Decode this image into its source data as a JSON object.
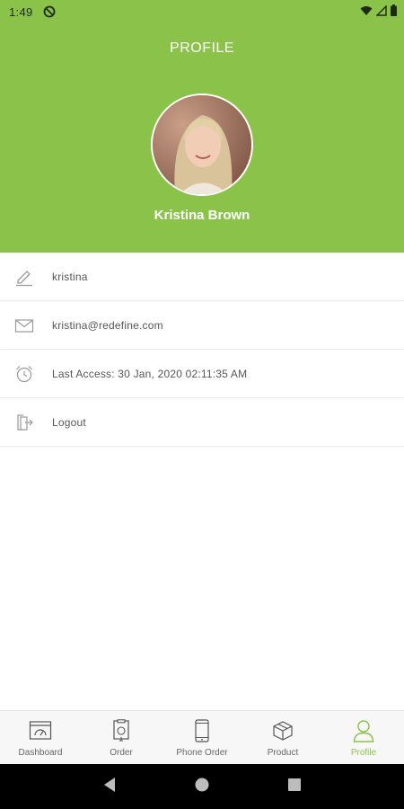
{
  "status_bar": {
    "time": "1:49"
  },
  "header": {
    "title": "PROFILE",
    "user_name": "Kristina Brown",
    "color": "#8bc34a"
  },
  "menu": [
    {
      "icon": "pencil-icon",
      "label": "kristina"
    },
    {
      "icon": "envelope-icon",
      "label": "kristina@redefine.com"
    },
    {
      "icon": "alarm-clock-icon",
      "label": "Last Access: 30 Jan, 2020  02:11:35 AM"
    },
    {
      "icon": "logout-icon",
      "label": "Logout"
    }
  ],
  "bottom_nav": [
    {
      "icon": "dashboard-icon",
      "label": "Dashboard",
      "active": false
    },
    {
      "icon": "order-icon",
      "label": "Order",
      "active": false
    },
    {
      "icon": "phone-icon",
      "label": "Phone Order",
      "active": false
    },
    {
      "icon": "box-icon",
      "label": "Product",
      "active": false
    },
    {
      "icon": "user-icon",
      "label": "Profile",
      "active": true
    }
  ],
  "active_color": "#8bc34a"
}
